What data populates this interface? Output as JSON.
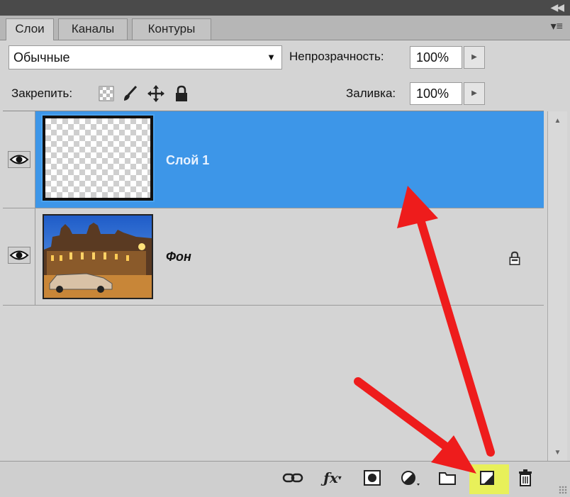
{
  "tabs": [
    {
      "label": "Слои",
      "active": true
    },
    {
      "label": "Каналы",
      "active": false
    },
    {
      "label": "Контуры",
      "active": false
    }
  ],
  "blend_mode": {
    "selected": "Обычные"
  },
  "opacity": {
    "label": "Непрозрачность:",
    "value": "100%"
  },
  "lock": {
    "label": "Закрепить:",
    "icons": [
      "lock-transparent-pixels-icon",
      "lock-image-pixels-icon",
      "lock-position-icon",
      "lock-all-icon"
    ]
  },
  "fill": {
    "label": "Заливка:",
    "value": "100%"
  },
  "layers": [
    {
      "name": "Слой 1",
      "selected": true,
      "visible": true,
      "locked": false
    },
    {
      "name": "Фон",
      "selected": false,
      "visible": true,
      "locked": true
    }
  ],
  "bottom_icons": [
    "link-layers-icon",
    "fx-icon",
    "layer-mask-icon",
    "adjustment-layer-icon",
    "new-group-icon",
    "new-layer-icon",
    "delete-layer-icon"
  ],
  "highlighted_icon": "new-layer-icon",
  "colors": {
    "selection": "#3d96e8",
    "panel": "#d4d4d4",
    "highlight": "#e8f05a",
    "annotation_arrow": "#ee1c1c"
  }
}
